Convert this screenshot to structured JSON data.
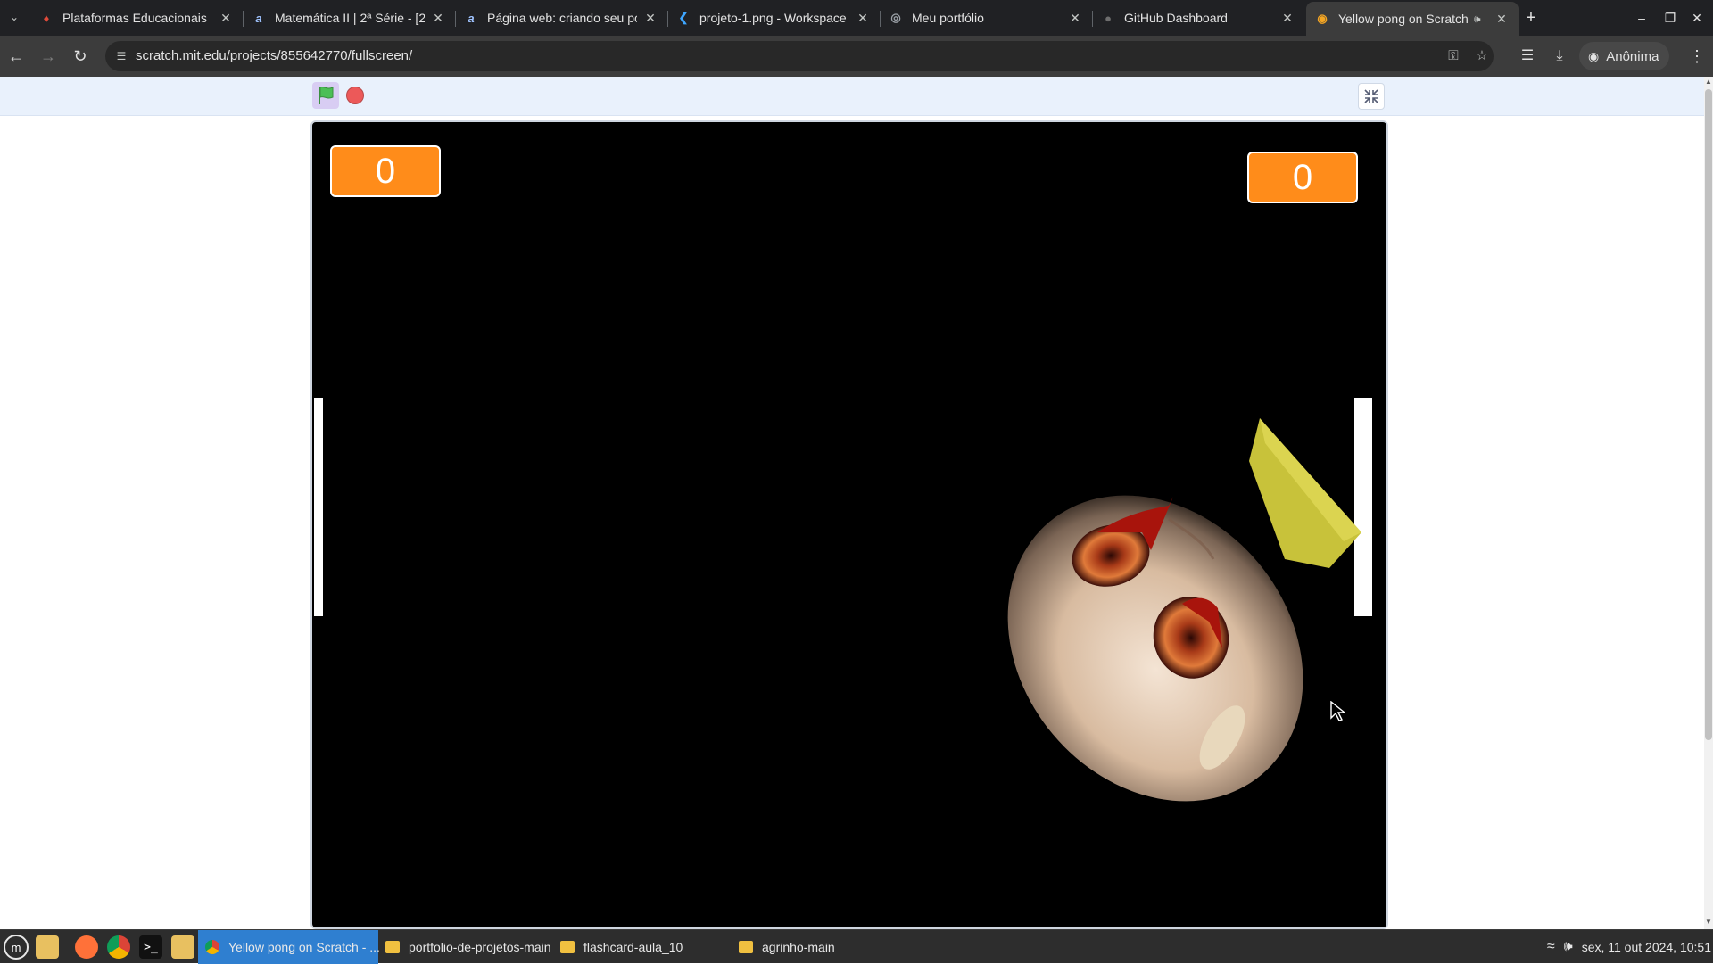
{
  "browser": {
    "tabs": [
      {
        "title": "Plataformas Educacionais",
        "favicon": "red-book-icon",
        "active": false
      },
      {
        "title": "Matemática II | 2ª Série - [20",
        "favicon": "alura-a-icon",
        "active": false
      },
      {
        "title": "Página web: criando seu por",
        "favicon": "alura-a-icon",
        "active": false
      },
      {
        "title": "projeto-1.png - Workspace -",
        "favicon": "vscode-icon",
        "active": false
      },
      {
        "title": "Meu portfólio",
        "favicon": "globe-icon",
        "active": false
      },
      {
        "title": "GitHub Dashboard",
        "favicon": "github-icon",
        "active": false
      },
      {
        "title": "Yellow pong on Scratch",
        "favicon": "scratch-icon",
        "active": true,
        "audio": true
      }
    ],
    "url": "scratch.mit.edu/projects/855642770/fullscreen/",
    "profile_label": "Anônima"
  },
  "scratch": {
    "score_left": "0",
    "score_right": "0"
  },
  "taskbar": {
    "items": [
      {
        "label": "Yellow pong on Scratch - ...",
        "icon": "chrome-icon",
        "active": true
      },
      {
        "label": "portfolio-de-projetos-main",
        "icon": "folder-icon",
        "active": false
      },
      {
        "label": "flashcard-aula_10",
        "icon": "folder-icon",
        "active": false
      },
      {
        "label": "agrinho-main",
        "icon": "folder-icon",
        "active": false
      }
    ],
    "clock": "sex, 11 out 2024, 10:51"
  },
  "colors": {
    "score_orange": "#ff8c1a",
    "taskbar_active": "#2f7fd0",
    "controls_bar": "#e9f1fc",
    "stop_red": "#ec5959",
    "flag_green": "#4cbf56"
  }
}
